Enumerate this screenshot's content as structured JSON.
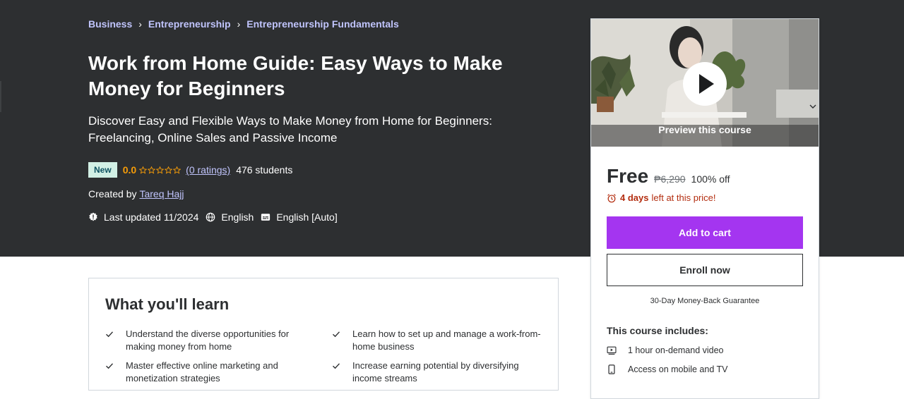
{
  "breadcrumb": [
    "Business",
    "Entrepreneurship",
    "Entrepreneurship Fundamentals"
  ],
  "course": {
    "title": "Work from Home Guide: Easy Ways to Make Money for Beginners",
    "subtitle": "Discover Easy and Flexible Ways to Make Money from Home for Beginners: Freelancing, Online Sales and Passive Income",
    "badge": "New",
    "rating": "0.0",
    "rating_value": 0,
    "stars_total": 5,
    "ratings_link": "(0 ratings)",
    "students": "476 students",
    "created_by_label": "Created by",
    "instructor": "Tareq Hajj",
    "last_updated": "Last updated 11/2024",
    "language": "English",
    "captions": "English [Auto]"
  },
  "learn": {
    "title": "What you'll learn",
    "items": [
      "Understand the diverse opportunities for making money from home",
      "Learn how to set up and manage a work-from-home business",
      "Master effective online marketing and monetization strategies",
      "Increase earning potential by diversifying income streams"
    ]
  },
  "sidebar": {
    "preview_label": "Preview this course",
    "price": "Free",
    "original_price": "₱6,290",
    "discount": "100% off",
    "timer_bold": "4 days",
    "timer_rest": "left at this price!",
    "add_to_cart": "Add to cart",
    "enroll": "Enroll now",
    "guarantee": "30-Day Money-Back Guarantee",
    "includes_title": "This course includes:",
    "includes": [
      {
        "icon": "video-icon",
        "label": "1 hour on-demand video"
      },
      {
        "icon": "mobile-icon",
        "label": "Access on mobile and TV"
      }
    ]
  },
  "colors": {
    "hero_bg": "#2d2f31",
    "link": "#c0c4fc",
    "accent_purple": "#a435f0",
    "rating_orange": "#f69c08",
    "badge_bg": "#d2f0e5",
    "timer_red": "#b32d0f"
  }
}
